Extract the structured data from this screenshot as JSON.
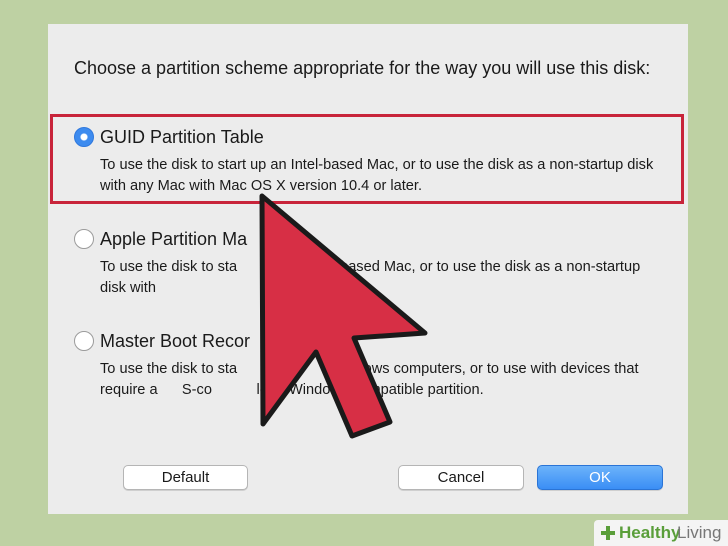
{
  "dialog": {
    "prompt": "Choose a partition scheme appropriate for the way you will use this disk:",
    "options": [
      {
        "title": "GUID Partition Table",
        "description": "To use the disk to start up an Intel-based Mac, or to use the disk as a non-startup disk with any Mac with Mac OS X version 10.4 or later.",
        "selected": true
      },
      {
        "title": "Apple Partition Ma",
        "description": "To use the disk to sta                erPC-based Mac, or to use the disk as a non-startup disk with",
        "selected": false
      },
      {
        "title": "Master Boot Recor",
        "description": "To use the disk to sta                       Windows computers, or to use with devices that require a      S-co           le or Windows-compatible partition.",
        "selected": false
      }
    ],
    "buttons": {
      "default": "Default",
      "cancel": "Cancel",
      "ok": "OK"
    }
  },
  "watermark": {
    "part1": "Healthy",
    "part2": "Living"
  },
  "colors": {
    "background": "#bed1a3",
    "highlight": "#c8243a",
    "arrow": "#d72f45",
    "accent": "#3d8bef"
  }
}
